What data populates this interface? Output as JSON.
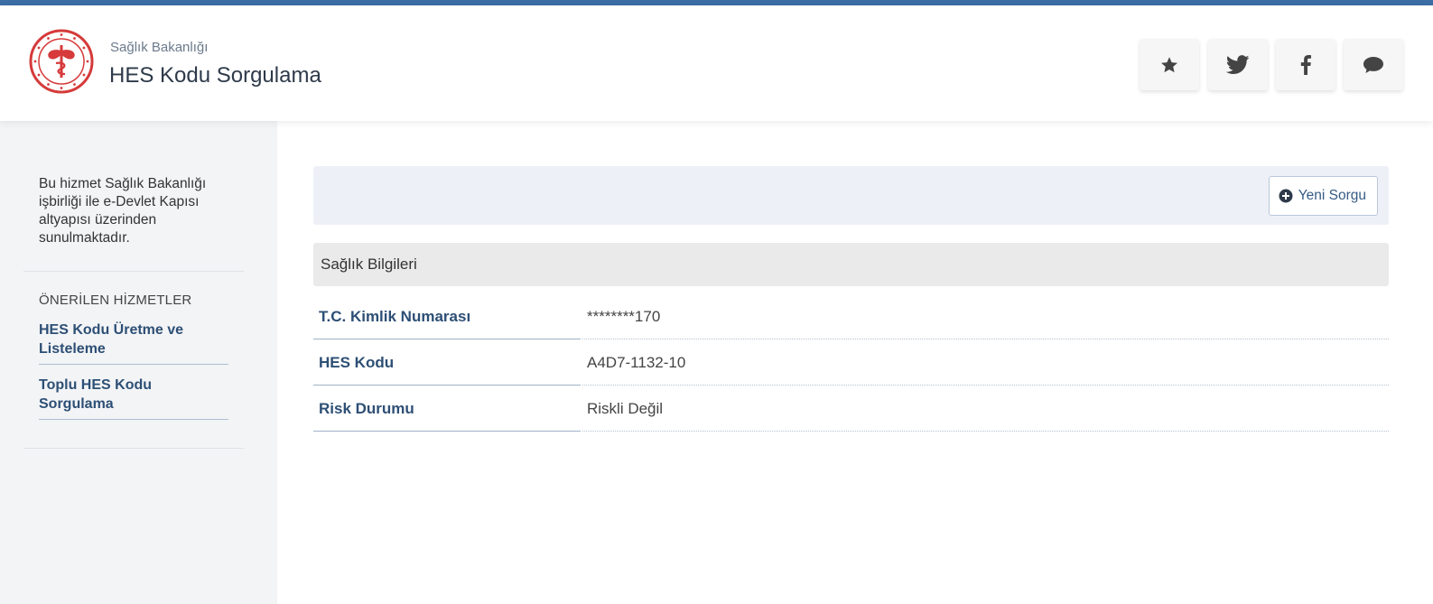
{
  "header": {
    "ministry": "Sağlık Bakanlığı",
    "title": "HES Kodu Sorgulama"
  },
  "social": [
    {
      "name": "favorite",
      "icon": "star-icon"
    },
    {
      "name": "twitter",
      "icon": "twitter-icon"
    },
    {
      "name": "facebook",
      "icon": "facebook-icon"
    },
    {
      "name": "comment",
      "icon": "comment-icon"
    }
  ],
  "sidebar": {
    "note": "Bu hizmet Sağlık Bakanlığı işbirliği ile e-Devlet Kapısı altyapısı üzerinden sunulmaktadır.",
    "heading": "ÖNERİLEN HİZMETLER",
    "links": [
      {
        "label": "HES Kodu Üretme ve Listeleme"
      },
      {
        "label": "Toplu HES Kodu Sorgulama"
      }
    ]
  },
  "toolbar": {
    "new_query_label": "Yeni Sorgu"
  },
  "section": {
    "title": "Sağlık Bilgileri"
  },
  "fields": [
    {
      "label": "T.C. Kimlik Numarası",
      "value": "********170"
    },
    {
      "label": "HES Kodu",
      "value": "A4D7-1132-10"
    },
    {
      "label": "Risk Durumu",
      "value": "Riskli Değil"
    }
  ],
  "colors": {
    "accent": "#3b6ea5",
    "link": "#2d4f75",
    "logo_red": "#d63a3a"
  }
}
